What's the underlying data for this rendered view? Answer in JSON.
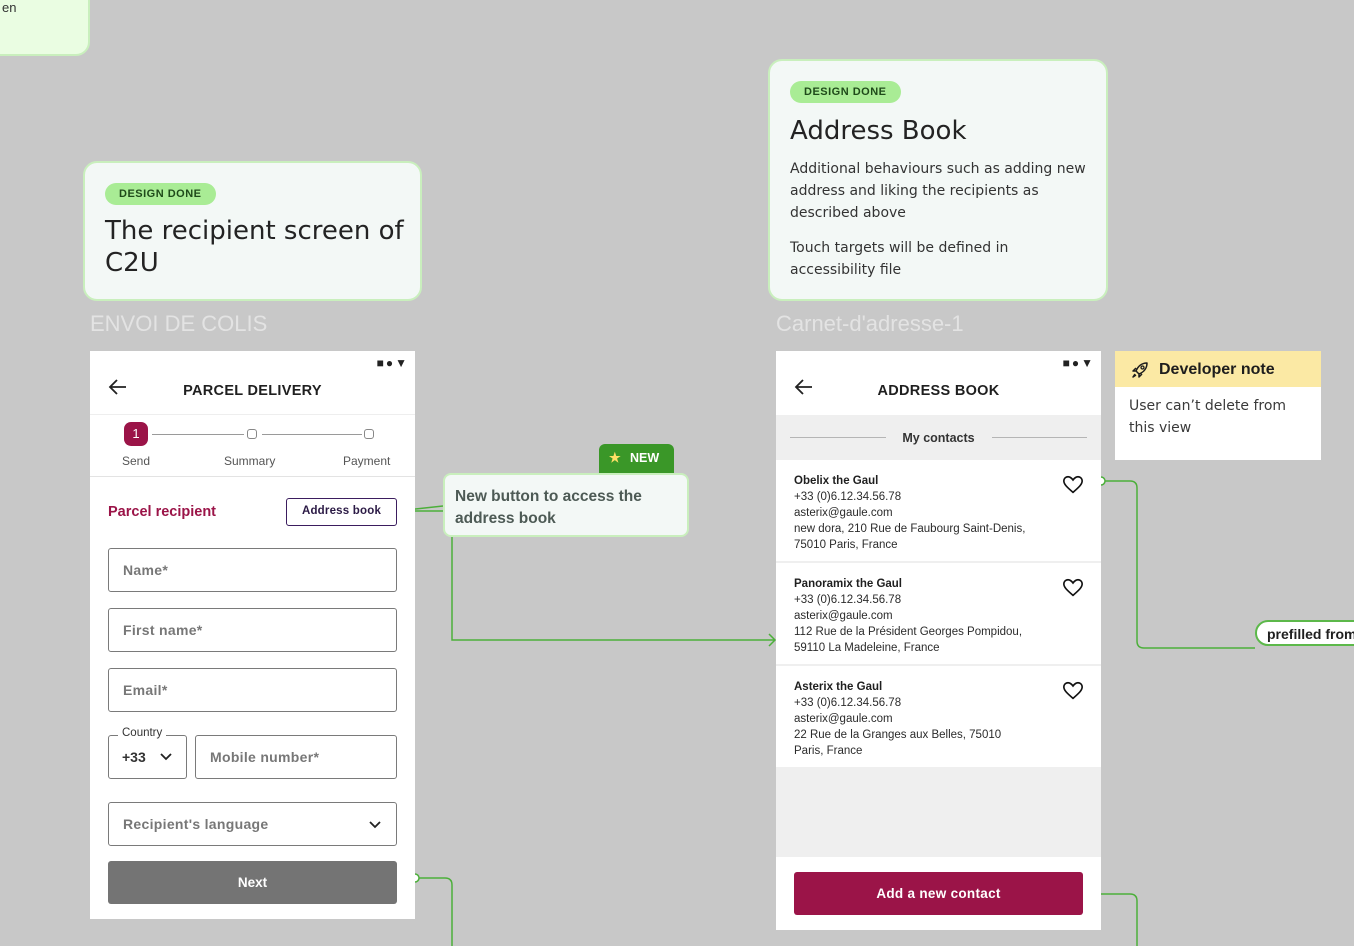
{
  "top_left_card": {
    "fragment": "en"
  },
  "recipient_card": {
    "badge": "DESIGN DONE",
    "title": "The recipient screen of C2U"
  },
  "address_card": {
    "badge": "DESIGN DONE",
    "title": "Address Book",
    "body1": "Additional behaviours such as adding new address and liking the recipients as described above",
    "body2": "Touch targets will be defined in accessibility file"
  },
  "frame_labels": {
    "left": "ENVOI DE COLIS",
    "right": "Carnet-d'adresse-1"
  },
  "parcel_screen": {
    "status_icons": "■●▼",
    "title": "PARCEL DELIVERY",
    "steps": [
      {
        "number": "1",
        "label": "Send"
      },
      {
        "label": "Summary"
      },
      {
        "label": "Payment"
      }
    ],
    "section_title": "Parcel recipient",
    "address_book_button": "Address book",
    "fields": {
      "name": "Name*",
      "first_name": "First name*",
      "email": "Email*",
      "country_label": "Country",
      "country_code": "+33",
      "mobile": "Mobile number*",
      "language": "Recipient's language"
    },
    "next_button": "Next"
  },
  "new_annotation": {
    "tag": "NEW",
    "text": "New button to access the address book"
  },
  "address_screen": {
    "status_icons": "■●▼",
    "title": "ADDRESS BOOK",
    "section": "My contacts",
    "contacts": [
      {
        "name": "Obelix the Gaul",
        "phone": "+33 (0)6.12.34.56.78",
        "email": "asterix@gaule.com",
        "addr1": "new dora, 210 Rue de Faubourg Saint-Denis,",
        "addr2": "75010 Paris, France"
      },
      {
        "name": "Panoramix the Gaul",
        "phone": "+33 (0)6.12.34.56.78",
        "email": "asterix@gaule.com",
        "addr1": "112 Rue de la Président Georges Pompidou,",
        "addr2": "59110 La Madeleine, France"
      },
      {
        "name": "Asterix the Gaul",
        "phone": "+33 (0)6.12.34.56.78",
        "email": "asterix@gaule.com",
        "addr1": "22 Rue de la Granges aux Belles, 75010",
        "addr2": "Paris, France"
      }
    ],
    "add_button": "Add a new contact"
  },
  "developer_note": {
    "title": "Developer note",
    "body": "User can’t delete from this view"
  },
  "prefill_tag": "prefilled from",
  "colors": {
    "brand": "#9b1448",
    "connector": "#4caf3a",
    "badge": "#a9ec95",
    "note": "#fbe9a4"
  }
}
